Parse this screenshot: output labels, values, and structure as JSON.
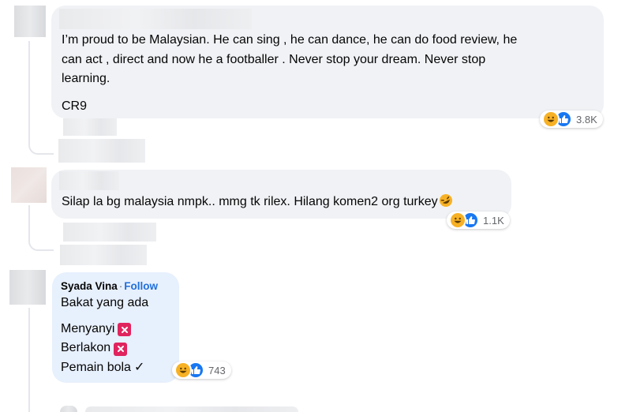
{
  "comments": [
    {
      "text": "I’m proud to be Malaysian. He can sing , he can dance, he can do food review, he\ncan act , direct and now he a footballer . Never stop your dream. Never stop\nlearning.",
      "signature": "CR9",
      "reactions": {
        "icons": [
          "haha-icon",
          "like-icon"
        ],
        "count": "3.8K"
      }
    },
    {
      "text": "Silap la bg malaysia nmpk.. mmg tk rilex. Hilang komen2 org turkey",
      "trailing_emoji": "rolling-laughing-emoji",
      "reactions": {
        "icons": [
          "haha-icon",
          "like-icon"
        ],
        "count": "1.1K"
      }
    },
    {
      "author": "Syada Vina",
      "separator": "·",
      "follow_label": "Follow",
      "intro": "Bakat yang ada",
      "list": [
        {
          "label": "Menyanyi",
          "mark": "cross-mark-icon"
        },
        {
          "label": "Berlakon",
          "mark": "cross-mark-icon"
        },
        {
          "label": "Pemain bola",
          "mark": "check-mark-icon",
          "mark_text": "✓"
        }
      ],
      "reactions": {
        "icons": [
          "haha-icon",
          "like-icon"
        ],
        "count": "743"
      }
    }
  ],
  "colors": {
    "bubble": "#f0f2f5",
    "bubble_highlight": "#e7f0fd",
    "follow": "#216fdb",
    "haha": "#f7b125",
    "like": "#1877f2",
    "cross": "#e0245e"
  }
}
